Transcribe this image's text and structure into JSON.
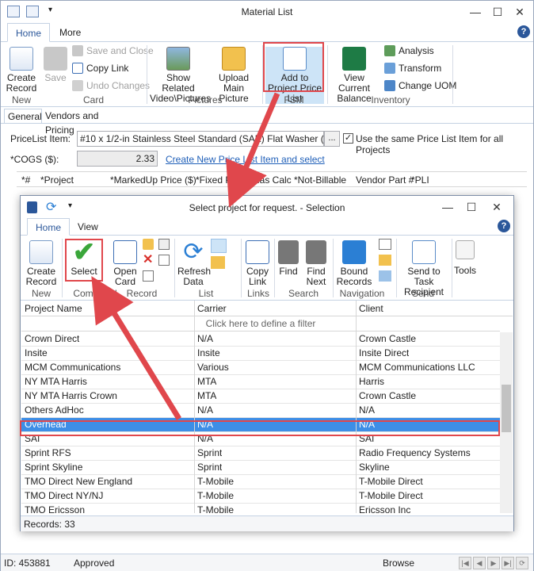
{
  "window": {
    "title": "Material List",
    "tabs": [
      "Home",
      "More"
    ],
    "help": "?"
  },
  "ribbon": {
    "create_record": "Create Record",
    "save": "Save",
    "save_and_close": "Save and Close",
    "copy_link": "Copy Link",
    "undo_changes": "Undo Changes",
    "show_related": "Show Related Video\\Pictures",
    "upload_main_picture": "Upload Main Picture",
    "add_to_project": "Add to Project Price List",
    "view_current_balance": "View Current Balance",
    "analysis": "Analysis",
    "transform": "Transform",
    "change_uom": "Change UOM",
    "groups": [
      "New",
      "Card",
      "Pictures",
      "FSM",
      "Inventory"
    ]
  },
  "subtabs": [
    "General",
    "Vendors and Pricing"
  ],
  "form": {
    "pricelist_label": "PriceList Item:",
    "pricelist_value": "#10 x 1/2-in Stainless Steel Standard (SAE) Flat Washer (36 Count)",
    "ellipsis": "...",
    "same_item_label": "Use the same Price List Item for all Projects",
    "cogs_label": "*COGS ($):",
    "cogs_value": "2.33",
    "create_link": "Create New Price List Item and select"
  },
  "grid_headers": [
    "*#",
    "*Project",
    "*MarkedUp Price ($)",
    "*Fixed Price",
    "Has Calc",
    "*Not-Billable",
    "Vendor Part #",
    "*PLI"
  ],
  "status": {
    "id": "ID: 453881",
    "state": "Approved",
    "mode": "Browse"
  },
  "dialog": {
    "title": "Select project for request. - Selection",
    "tabs": [
      "Home",
      "View"
    ],
    "help": "?",
    "buttons": {
      "create_record": "Create Record",
      "select": "Select",
      "open_card": "Open Card",
      "refresh_data": "Refresh Data",
      "copy_link": "Copy Link",
      "find": "Find",
      "find_next": "Find Next",
      "bound_records": "Bound Records",
      "send_to_task_recipient": "Send to Task Recipient",
      "tools": "Tools"
    },
    "groups": [
      "New",
      "Command",
      "Record",
      "List",
      "Links",
      "Search",
      "Navigation",
      "Send"
    ],
    "columns": [
      "Project Name",
      "Carrier",
      "Client"
    ],
    "filter_hint": "Click here to define a filter",
    "rows": [
      [
        "Crown Direct",
        "N/A",
        "Crown Castle"
      ],
      [
        "Insite",
        "Insite",
        "Insite Direct"
      ],
      [
        "MCM Communications",
        "Various",
        "MCM Communications LLC"
      ],
      [
        "NY MTA Harris",
        "MTA",
        "Harris"
      ],
      [
        "NY MTA Harris Crown",
        "MTA",
        "Crown Castle"
      ],
      [
        "Others AdHoc",
        "N/A",
        "N/A"
      ],
      [
        "Overhead",
        "N/A",
        "N/A"
      ],
      [
        "SAI",
        "N/A",
        "SAI"
      ],
      [
        "Sprint RFS",
        "Sprint",
        "Radio Frequency Systems"
      ],
      [
        "Sprint Skyline",
        "Sprint",
        "Skyline"
      ],
      [
        "TMO Direct New England",
        "T-Mobile",
        "T-Mobile Direct"
      ],
      [
        "TMO Direct NY/NJ",
        "T-Mobile",
        "T-Mobile Direct"
      ],
      [
        "TMO Ericsson",
        "T-Mobile",
        "Ericsson Inc"
      ]
    ],
    "selected_row": 6,
    "records": "Records: 33"
  },
  "colors": {
    "accent": "#2b579a",
    "selection": "#3d8ee6",
    "annotation": "#e0474c"
  }
}
